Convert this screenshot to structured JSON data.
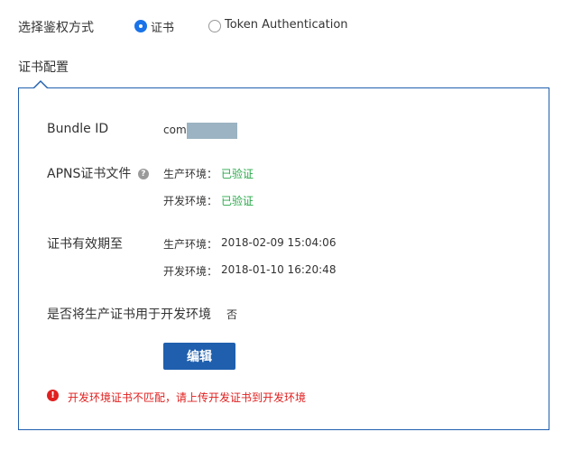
{
  "auth": {
    "label": "选择鉴权方式",
    "options": [
      {
        "label": "证书",
        "selected": true
      },
      {
        "label": "Token Authentication",
        "selected": false
      }
    ]
  },
  "cert_config": {
    "title": "证书配置",
    "bundle_id": {
      "label": "Bundle ID",
      "value": "com."
    },
    "apns_file": {
      "label": "APNS证书文件",
      "help_icon": "?",
      "production": {
        "label": "生产环境：",
        "value": "已验证"
      },
      "development": {
        "label": "开发环境：",
        "value": "已验证"
      }
    },
    "validity": {
      "label": "证书有效期至",
      "production": {
        "label": "生产环境：",
        "value": "2018-02-09 15:04:06"
      },
      "development": {
        "label": "开发环境：",
        "value": "2018-01-10 16:20:48"
      }
    },
    "use_prod_for_dev": {
      "label": "是否将生产证书用于开发环境",
      "value": "否"
    },
    "edit_button": "编辑",
    "error": {
      "icon": "!",
      "message": "开发环境证书不匹配，请上传开发证书到开发环境"
    }
  },
  "colors": {
    "accent": "#1a73e8",
    "panel_border": "#1f5fae",
    "success": "#2aa84a",
    "error": "#e02020"
  }
}
